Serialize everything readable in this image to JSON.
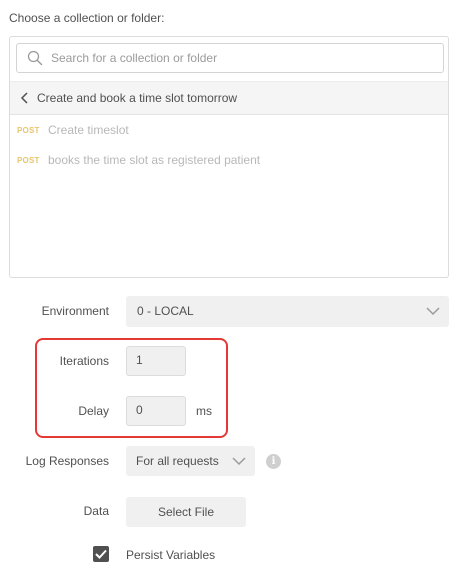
{
  "heading": "Choose a collection or folder:",
  "search": {
    "placeholder": "Search for a collection or folder"
  },
  "folder": {
    "title": "Create and book a time slot tomorrow"
  },
  "requests": [
    {
      "method": "POST",
      "name": "Create timeslot"
    },
    {
      "method": "POST",
      "name": "books the time slot as registered patient"
    }
  ],
  "environment": {
    "label": "Environment",
    "value": "0 - LOCAL"
  },
  "iterations": {
    "label": "Iterations",
    "value": "1"
  },
  "delay": {
    "label": "Delay",
    "value": "0",
    "unit": "ms"
  },
  "log_responses": {
    "label": "Log Responses",
    "value": "For all requests"
  },
  "data": {
    "label": "Data",
    "button": "Select File"
  },
  "persist": {
    "label": "Persist Variables",
    "checked": true
  },
  "colors": {
    "highlight": "#e53935",
    "post_method": "#e8c66d"
  },
  "icons": [
    "search-icon",
    "chevron-left-icon",
    "chevron-down-icon",
    "info-icon",
    "checkmark-icon"
  ]
}
